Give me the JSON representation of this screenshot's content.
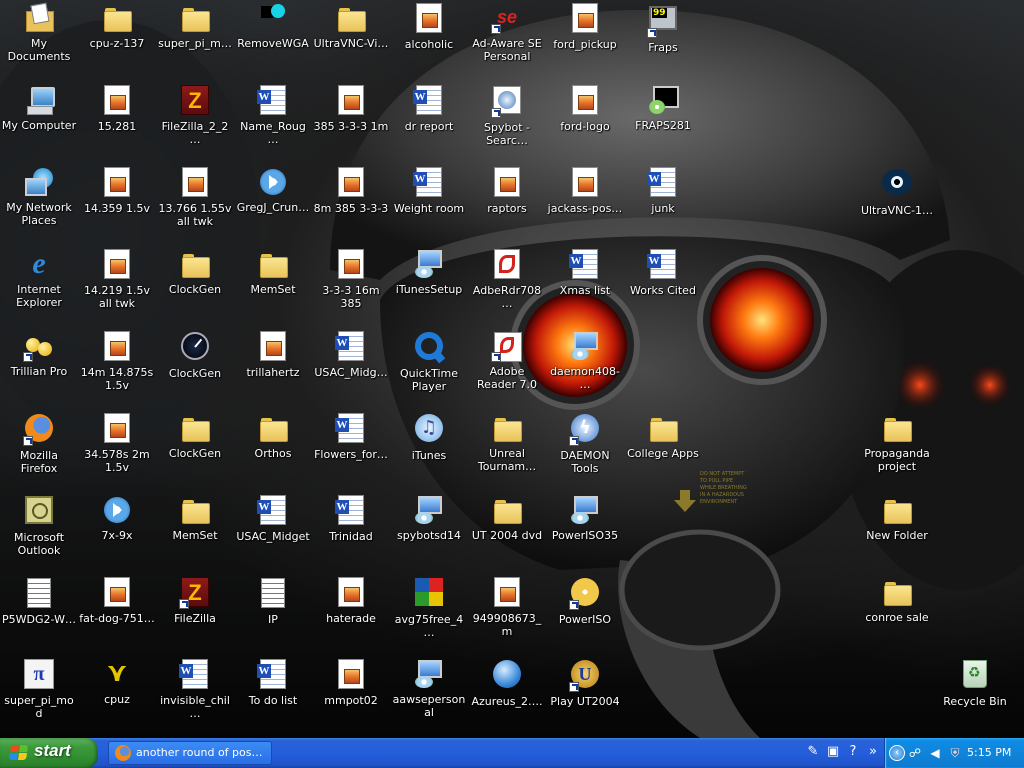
{
  "desktop": {
    "icons": [
      {
        "label": "My Documents",
        "icon": "my-documents-icon",
        "col": 0,
        "row": 0
      },
      {
        "label": "My Computer",
        "icon": "my-computer-icon",
        "col": 0,
        "row": 1
      },
      {
        "label": "My Network Places",
        "icon": "network-places-icon",
        "col": 0,
        "row": 2
      },
      {
        "label": "Internet Explorer",
        "icon": "internet-explorer-icon",
        "col": 0,
        "row": 3
      },
      {
        "label": "Trillian Pro",
        "icon": "trillian-icon",
        "col": 0,
        "row": 4,
        "shortcut": true
      },
      {
        "label": "Mozilla Firefox",
        "icon": "firefox-icon",
        "col": 0,
        "row": 5,
        "shortcut": true
      },
      {
        "label": "Microsoft Outlook",
        "icon": "outlook-icon",
        "col": 0,
        "row": 6
      },
      {
        "label": "P5WDG2-W…",
        "icon": "document-icon",
        "col": 0,
        "row": 7
      },
      {
        "label": "super_pi_mod",
        "icon": "super-pi-icon",
        "col": 0,
        "row": 8
      },
      {
        "label": "cpu-z-137",
        "icon": "folder-icon",
        "col": 1,
        "row": 0
      },
      {
        "label": "15.281",
        "icon": "archive-file-icon",
        "col": 1,
        "row": 1
      },
      {
        "label": "14.359 1.5v",
        "icon": "archive-file-icon",
        "col": 1,
        "row": 2
      },
      {
        "label": "14.219 1.5v all twk",
        "icon": "archive-file-icon",
        "col": 1,
        "row": 3
      },
      {
        "label": "14m 14.875s 1.5v",
        "icon": "archive-file-icon",
        "col": 1,
        "row": 4
      },
      {
        "label": "34.578s 2m 1.5v",
        "icon": "archive-file-icon",
        "col": 1,
        "row": 5
      },
      {
        "label": "7x-9x",
        "icon": "media-player-icon",
        "col": 1,
        "row": 6
      },
      {
        "label": "fat-dog-751…",
        "icon": "archive-file-icon",
        "col": 1,
        "row": 7
      },
      {
        "label": "cpuz",
        "icon": "cpuz-icon",
        "col": 1,
        "row": 8
      },
      {
        "label": "super_pi_m…",
        "icon": "folder-icon",
        "col": 2,
        "row": 0
      },
      {
        "label": "FileZilla_2_2…",
        "icon": "filezilla-icon",
        "col": 2,
        "row": 1
      },
      {
        "label": "13.766 1.55v all twk",
        "icon": "archive-file-icon",
        "col": 2,
        "row": 2
      },
      {
        "label": "ClockGen",
        "icon": "folder-icon",
        "col": 2,
        "row": 3
      },
      {
        "label": "ClockGen",
        "icon": "clockgen-icon",
        "col": 2,
        "row": 4
      },
      {
        "label": "ClockGen",
        "icon": "zip-folder-icon",
        "col": 2,
        "row": 5
      },
      {
        "label": "MemSet",
        "icon": "zip-folder-icon",
        "col": 2,
        "row": 6
      },
      {
        "label": "FileZilla",
        "icon": "filezilla-icon",
        "col": 2,
        "row": 7,
        "shortcut": true
      },
      {
        "label": "invisible_chil…",
        "icon": "word-document-icon",
        "col": 2,
        "row": 8
      },
      {
        "label": "RemoveWGA",
        "icon": "removewga-icon",
        "col": 3,
        "row": 0
      },
      {
        "label": "Name_Roug…",
        "icon": "word-document-icon",
        "col": 3,
        "row": 1
      },
      {
        "label": "GregJ_Crun…",
        "icon": "media-player-icon",
        "col": 3,
        "row": 2
      },
      {
        "label": "MemSet",
        "icon": "folder-icon",
        "col": 3,
        "row": 3
      },
      {
        "label": "trillahertz",
        "icon": "archive-file-icon",
        "col": 3,
        "row": 4
      },
      {
        "label": "Orthos",
        "icon": "folder-icon",
        "col": 3,
        "row": 5
      },
      {
        "label": "USAC_Midget",
        "icon": "word-document-icon",
        "col": 3,
        "row": 6
      },
      {
        "label": "IP",
        "icon": "text-file-icon",
        "col": 3,
        "row": 7
      },
      {
        "label": "To do list",
        "icon": "word-document-icon",
        "col": 3,
        "row": 8
      },
      {
        "label": "UltraVNC-Vi…",
        "icon": "folder-icon",
        "col": 4,
        "row": 0
      },
      {
        "label": "385 3-3-3 1m",
        "icon": "archive-file-icon",
        "col": 4,
        "row": 1
      },
      {
        "label": "8m 385 3-3-3",
        "icon": "archive-file-icon",
        "col": 4,
        "row": 2
      },
      {
        "label": "3-3-3 16m 385",
        "icon": "archive-file-icon",
        "col": 4,
        "row": 3
      },
      {
        "label": "USAC_Midg…",
        "icon": "word-document-icon",
        "col": 4,
        "row": 4
      },
      {
        "label": "Flowers_for…",
        "icon": "word-document-icon",
        "col": 4,
        "row": 5
      },
      {
        "label": "Trinidad",
        "icon": "word-document-icon",
        "col": 4,
        "row": 6
      },
      {
        "label": "haterade",
        "icon": "archive-file-icon",
        "col": 4,
        "row": 7
      },
      {
        "label": "mmpot02",
        "icon": "archive-file-icon",
        "col": 4,
        "row": 8
      },
      {
        "label": "alcoholic",
        "icon": "archive-file-icon",
        "col": 5,
        "row": 0
      },
      {
        "label": "dr report",
        "icon": "word-document-icon",
        "col": 5,
        "row": 1
      },
      {
        "label": "Weight room",
        "icon": "word-document-icon",
        "col": 5,
        "row": 2
      },
      {
        "label": "iTunesSetup",
        "icon": "installer-icon",
        "col": 5,
        "row": 3
      },
      {
        "label": "QuickTime Player",
        "icon": "quicktime-icon",
        "col": 5,
        "row": 4
      },
      {
        "label": "iTunes",
        "icon": "itunes-icon",
        "col": 5,
        "row": 5
      },
      {
        "label": "spybotsd14",
        "icon": "setup-icon",
        "col": 5,
        "row": 6
      },
      {
        "label": "avg75free_4…",
        "icon": "avg-icon",
        "col": 5,
        "row": 7
      },
      {
        "label": "aawsepersonal",
        "icon": "setup-icon",
        "col": 5,
        "row": 8
      },
      {
        "label": "Ad-Aware SE Personal",
        "icon": "adaware-icon",
        "col": 6,
        "row": 0,
        "shortcut": true
      },
      {
        "label": "Spybot - Searc…",
        "icon": "spybot-icon",
        "col": 6,
        "row": 1,
        "shortcut": true
      },
      {
        "label": "raptors",
        "icon": "archive-file-icon",
        "col": 6,
        "row": 2
      },
      {
        "label": "AdbeRdr708…",
        "icon": "acrobat-installer-icon",
        "col": 6,
        "row": 3
      },
      {
        "label": "Adobe Reader 7.0",
        "icon": "adobe-reader-icon",
        "col": 6,
        "row": 4,
        "shortcut": true
      },
      {
        "label": "Unreal Tournam…",
        "icon": "folder-icon",
        "col": 6,
        "row": 5
      },
      {
        "label": "UT 2004 dvd",
        "icon": "folder-icon",
        "col": 6,
        "row": 6
      },
      {
        "label": "949908673_m",
        "icon": "archive-file-icon",
        "col": 6,
        "row": 7
      },
      {
        "label": "Azureus_2….",
        "icon": "azureus-icon",
        "col": 6,
        "row": 8
      },
      {
        "label": "ford_pickup",
        "icon": "archive-file-icon",
        "col": 7,
        "row": 0
      },
      {
        "label": "ford-logo",
        "icon": "archive-file-icon",
        "col": 7,
        "row": 1
      },
      {
        "label": "jackass-pos…",
        "icon": "archive-file-icon",
        "col": 7,
        "row": 2
      },
      {
        "label": "Xmas list",
        "icon": "word-document-icon",
        "col": 7,
        "row": 3
      },
      {
        "label": "daemon408-…",
        "icon": "setup-icon",
        "col": 7,
        "row": 4
      },
      {
        "label": "DAEMON Tools",
        "icon": "daemon-tools-icon",
        "col": 7,
        "row": 5,
        "shortcut": true
      },
      {
        "label": "PowerISO35",
        "icon": "setup-icon",
        "col": 7,
        "row": 6
      },
      {
        "label": "PowerISO",
        "icon": "poweriso-icon",
        "col": 7,
        "row": 7,
        "shortcut": true
      },
      {
        "label": "Play UT2004",
        "icon": "ut2004-icon",
        "col": 7,
        "row": 8,
        "shortcut": true
      },
      {
        "label": "Fraps",
        "icon": "fraps-icon",
        "col": 8,
        "row": 0,
        "shortcut": true
      },
      {
        "label": "FRAPS281",
        "icon": "fraps-setup-icon",
        "col": 8,
        "row": 1
      },
      {
        "label": "junk",
        "icon": "word-document-icon",
        "col": 8,
        "row": 2
      },
      {
        "label": "Works Cited",
        "icon": "word-document-icon",
        "col": 8,
        "row": 3
      },
      {
        "label": "College Apps",
        "icon": "folder-icon",
        "col": 8,
        "row": 5
      },
      {
        "label": "UltraVNC-1…",
        "icon": "ultravnc-icon",
        "col": 11,
        "row": 2
      },
      {
        "label": "Propaganda project",
        "icon": "folder-icon",
        "col": 11,
        "row": 5
      },
      {
        "label": "New Folder",
        "icon": "folder-icon",
        "col": 11,
        "row": 6
      },
      {
        "label": "conroe sale",
        "icon": "folder-icon",
        "col": 11,
        "row": 7
      },
      {
        "label": "Recycle Bin",
        "icon": "recycle-bin-icon",
        "col": 12,
        "row": 8
      }
    ]
  },
  "taskbar": {
    "start_label": "start",
    "task_item_label": "another round of pos…",
    "clock": "5:15 PM",
    "colors": {
      "taskbar": "#245edb",
      "start": "#3c9a3c",
      "tray": "#0f8be6"
    }
  }
}
